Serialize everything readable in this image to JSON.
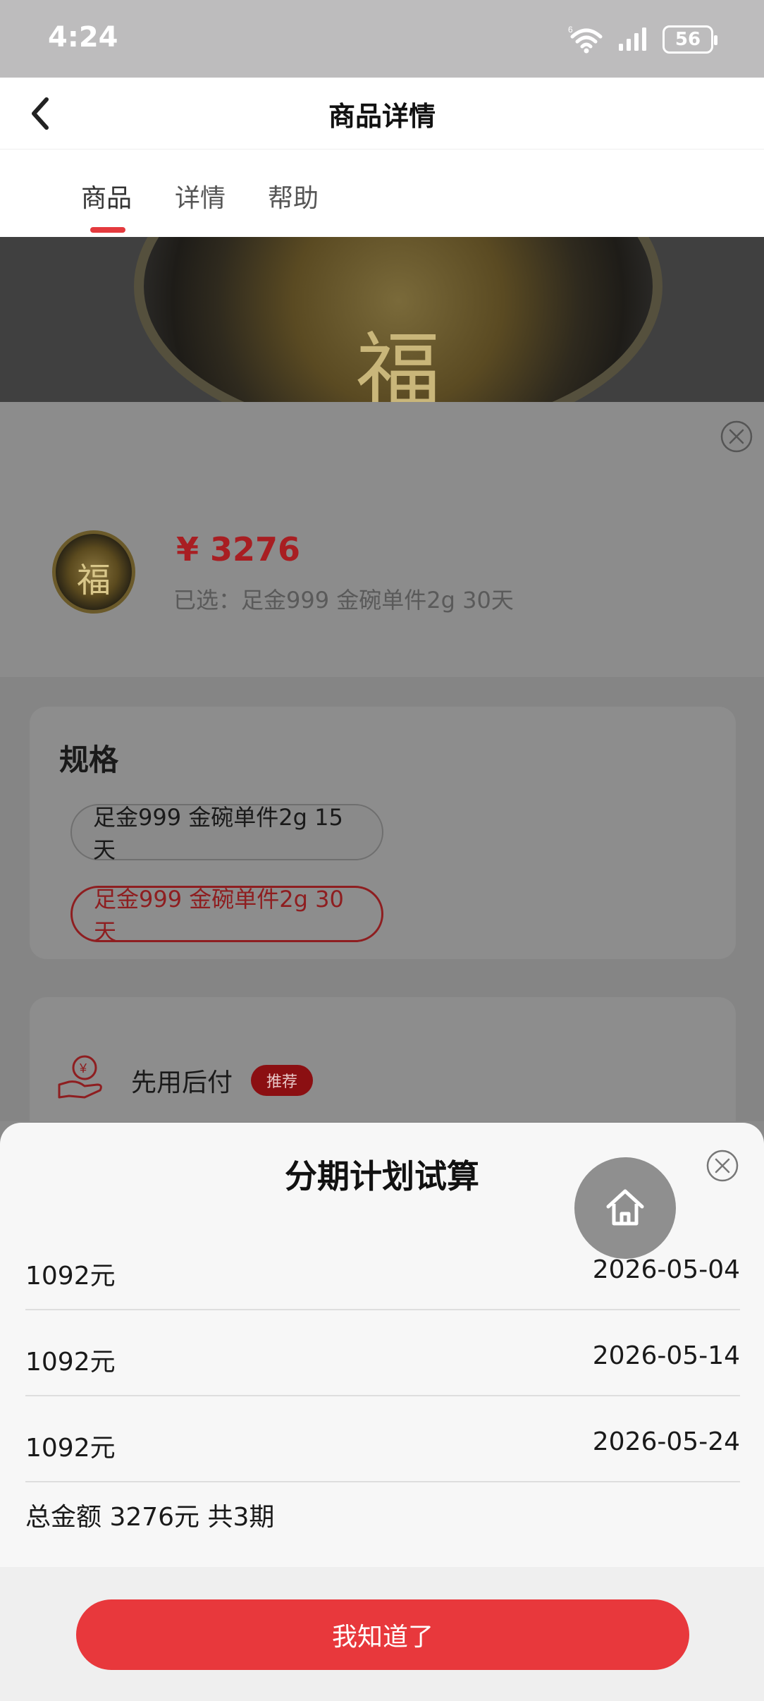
{
  "status_bar": {
    "time": "4:24",
    "battery": "56",
    "network": "6"
  },
  "header": {
    "title": "商品详情"
  },
  "tabs": [
    {
      "label": "商品",
      "active": true
    },
    {
      "label": "详情",
      "active": false
    },
    {
      "label": "帮助",
      "active": false
    }
  ],
  "product": {
    "price": "¥ 3276",
    "selected": "已选：足金999 金碗单件2g 30天",
    "coin_char": "福"
  },
  "spec": {
    "title": "规格",
    "options": [
      {
        "label": "足金999 金碗单件2g 15天",
        "selected": false
      },
      {
        "label": "足金999 金碗单件2g 30天",
        "selected": true
      }
    ]
  },
  "payment": {
    "label": "先用后付",
    "badge": "推荐"
  },
  "plan_sheet": {
    "title": "分期计划试算",
    "rows": [
      {
        "amount": "1092元",
        "date": "2026-05-04"
      },
      {
        "amount": "1092元",
        "date": "2026-05-14"
      },
      {
        "amount": "1092元",
        "date": "2026-05-24"
      }
    ],
    "summary": "总金额 3276元 共3期",
    "confirm_label": "我知道了"
  },
  "colors": {
    "accent": "#e8383c",
    "price": "#a81e22",
    "overlay": "#8a8a8a"
  }
}
